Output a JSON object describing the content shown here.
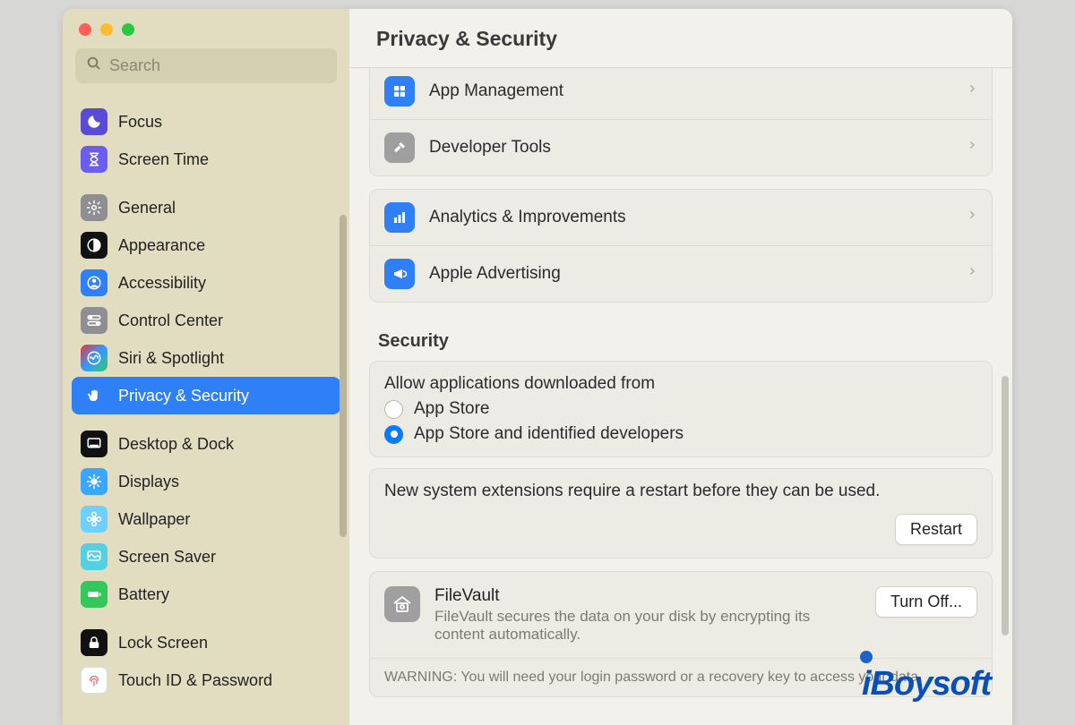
{
  "header": {
    "title": "Privacy & Security"
  },
  "search": {
    "placeholder": "Search"
  },
  "sidebar": {
    "items": [
      {
        "label": "Focus",
        "icon": "moon",
        "bg": "#5a4bd6"
      },
      {
        "label": "Screen Time",
        "icon": "hourglass",
        "bg": "#6a5ef0"
      },
      {
        "label": "General",
        "icon": "gear",
        "bg": "#8e8e93"
      },
      {
        "label": "Appearance",
        "icon": "contrast",
        "bg": "#111"
      },
      {
        "label": "Accessibility",
        "icon": "person",
        "bg": "#2f7ff6"
      },
      {
        "label": "Control Center",
        "icon": "switches",
        "bg": "#8e8e93"
      },
      {
        "label": "Siri & Spotlight",
        "icon": "siri",
        "bg": "linear-gradient(135deg,#e33,#39f,#3c6)"
      },
      {
        "label": "Privacy & Security",
        "icon": "hand",
        "bg": "#2f7ff6",
        "selected": true
      },
      {
        "label": "Desktop & Dock",
        "icon": "dock",
        "bg": "#111"
      },
      {
        "label": "Displays",
        "icon": "sun",
        "bg": "#39a7ff"
      },
      {
        "label": "Wallpaper",
        "icon": "flower",
        "bg": "#6fcfff"
      },
      {
        "label": "Screen Saver",
        "icon": "screensaver",
        "bg": "#55d0e0"
      },
      {
        "label": "Battery",
        "icon": "battery",
        "bg": "#34c759"
      },
      {
        "label": "Lock Screen",
        "icon": "lock",
        "bg": "#111"
      },
      {
        "label": "Touch ID & Password",
        "icon": "fingerprint",
        "bg": "#fff"
      }
    ]
  },
  "top_rows": [
    {
      "label": "App Management",
      "icon": "apps",
      "bg": "#2f7ff6"
    },
    {
      "label": "Developer Tools",
      "icon": "hammer",
      "bg": "#9f9f9f"
    }
  ],
  "mid_rows": [
    {
      "label": "Analytics & Improvements",
      "icon": "bars",
      "bg": "#2f7ff6"
    },
    {
      "label": "Apple Advertising",
      "icon": "megaphone",
      "bg": "#2f7ff6"
    }
  ],
  "security": {
    "heading": "Security",
    "allow_label": "Allow applications downloaded from",
    "option_a": "App Store",
    "option_b": "App Store and identified developers",
    "selected": "b",
    "ext_msg": "New system extensions require a restart before they can be used.",
    "restart_btn": "Restart"
  },
  "filevault": {
    "title": "FileVault",
    "desc": "FileVault secures the data on your disk by encrypting its content automatically.",
    "btn": "Turn Off...",
    "warning": "WARNING: You will need your login password or a recovery key to access your data."
  },
  "watermark": "iBoysoft"
}
